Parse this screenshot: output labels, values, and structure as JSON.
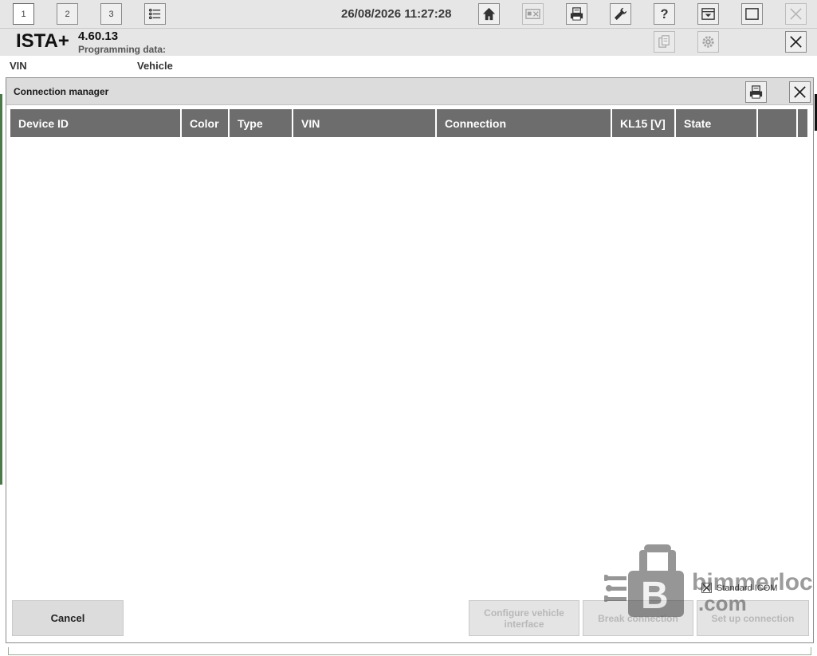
{
  "toolbar": {
    "tab1": "1",
    "tab2": "2",
    "tab3": "3",
    "datetime": "26/08/2026 11:27:28",
    "icons": [
      "list-icon",
      "home-icon",
      "id-card-icon",
      "print-icon",
      "wrench-icon",
      "help-icon",
      "dropdown-window-icon",
      "maximize-icon",
      "close-icon"
    ]
  },
  "header": {
    "app_name": "ISTA+",
    "version": "4.60.13",
    "programming_label": "Programming data:",
    "icons": [
      "document-stack-icon",
      "gear-icon",
      "close-icon"
    ]
  },
  "vehicle_bar": {
    "vin_label": "VIN",
    "vehicle_label": "Vehicle"
  },
  "dialog": {
    "title": "Connection manager",
    "columns": [
      "Device ID",
      "Color",
      "Type",
      "VIN",
      "Connection",
      "KL15 [V]",
      "State",
      ""
    ],
    "rows": [],
    "standard_icom_label": "Standard ICOM",
    "standard_icom_checked": true,
    "buttons": {
      "cancel": "Cancel",
      "configure": "Configure vehicle interface",
      "break": "Break connection",
      "setup": "Set up connection"
    }
  },
  "watermark": {
    "brand": "bimmerlock",
    "domain": ".com"
  },
  "colors": {
    "chrome": "#e6e6e6",
    "header_column": "#6d6d6d",
    "button": "#dcdcdc",
    "disabled_text": "#b8b8b8"
  }
}
